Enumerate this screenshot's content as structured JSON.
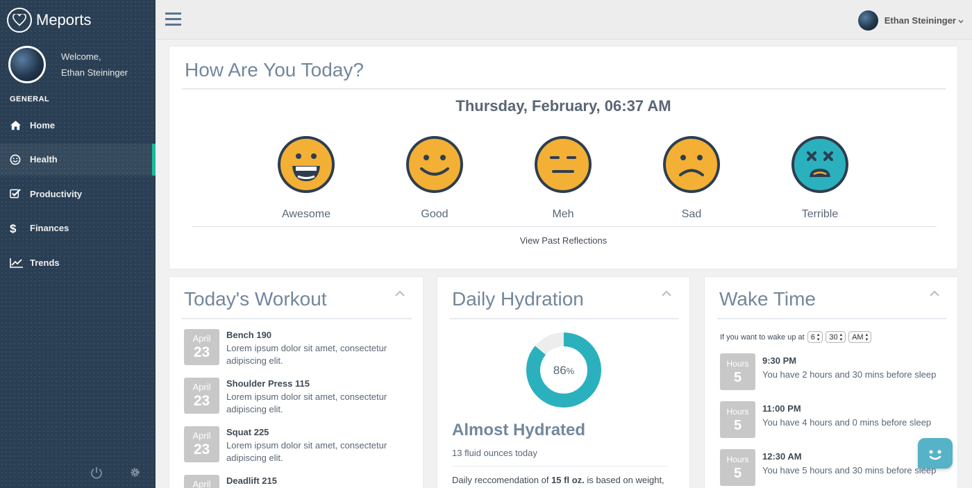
{
  "brand": {
    "name": "Meports"
  },
  "profile": {
    "welcome": "Welcome,",
    "name": "Ethan Steininger"
  },
  "sidebar": {
    "section_title": "GENERAL",
    "items": [
      {
        "label": "Home",
        "icon": "home-icon"
      },
      {
        "label": "Health",
        "icon": "smile-icon",
        "active": true
      },
      {
        "label": "Productivity",
        "icon": "checkbox-icon"
      },
      {
        "label": "Finances",
        "icon": "dollar-icon"
      },
      {
        "label": "Trends",
        "icon": "line-chart-icon"
      }
    ]
  },
  "topbar": {
    "user_name": "Ethan Steininger"
  },
  "mood": {
    "title": "How Are You Today?",
    "date": "Thursday, February, 06:37 AM",
    "options": [
      {
        "label": "Awesome",
        "color": "#f3b035"
      },
      {
        "label": "Good",
        "color": "#f3b035"
      },
      {
        "label": "Meh",
        "color": "#f3b035"
      },
      {
        "label": "Sad",
        "color": "#f3b035"
      },
      {
        "label": "Terrible",
        "color": "#2ab1bd"
      }
    ],
    "past_link": "View Past Reflections"
  },
  "workout": {
    "title": "Today's Workout",
    "items": [
      {
        "month": "April",
        "day": "23",
        "title": "Bench 190",
        "desc": "Lorem ipsum dolor sit amet, consectetur adipiscing elit."
      },
      {
        "month": "April",
        "day": "23",
        "title": "Shoulder Press 115",
        "desc": "Lorem ipsum dolor sit amet, consectetur adipiscing elit."
      },
      {
        "month": "April",
        "day": "23",
        "title": "Squat 225",
        "desc": "Lorem ipsum dolor sit amet, consectetur adipiscing elit."
      },
      {
        "month": "April",
        "title": "Deadlift 215"
      }
    ]
  },
  "hydration": {
    "title": "Daily Hydration",
    "percent": 86,
    "percent_value": "86",
    "percent_sign": "%",
    "status": "Almost Hydrated",
    "sub": "13 fluid ounces today",
    "note_prefix": "Daily reccomendation of ",
    "note_bold": "15 fl oz.",
    "note_suffix": " is based on weight,",
    "accent": "#2ab1bd"
  },
  "wake": {
    "title": "Wake Time",
    "form_label": "If you want to wake up at",
    "hour": "6",
    "minute": "30",
    "ampm": "AM",
    "items": [
      {
        "unit": "Hours",
        "value": "5",
        "time": "9:30 PM",
        "desc": "You have 2 hours and 30 mins before sleep"
      },
      {
        "unit": "Hours",
        "value": "5",
        "time": "11:00 PM",
        "desc": "You have 4 hours and 0 mins before sleep"
      },
      {
        "unit": "Hours",
        "value": "5",
        "time": "12:30 AM",
        "desc": "You have 5 hours and 30 mins before sleep"
      }
    ]
  }
}
